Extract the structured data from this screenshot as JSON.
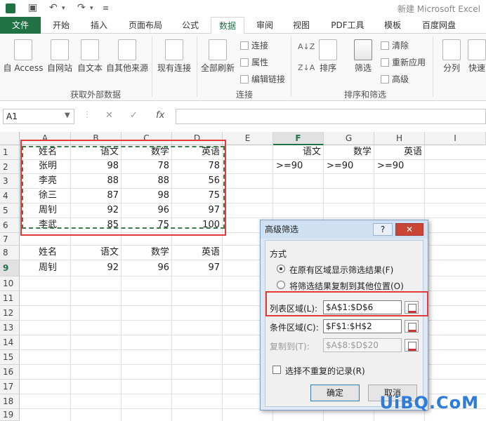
{
  "app": {
    "title": "新建 Microsoft Excel"
  },
  "tabs": [
    "文件",
    "开始",
    "插入",
    "页面布局",
    "公式",
    "数据",
    "审阅",
    "视图",
    "PDF工具",
    "模板",
    "百度网盘"
  ],
  "ribbon": {
    "external_buttons": [
      "自 Access",
      "自网站",
      "自文本",
      "自其他来源",
      "现有连接"
    ],
    "refresh_all": "全部刷新",
    "connections_items": [
      "连接",
      "属性",
      "编辑链接"
    ],
    "sort": "排序",
    "filter": "筛选",
    "filter_items": [
      "清除",
      "重新应用",
      "高级"
    ],
    "split": "分列",
    "quick": "快速",
    "groups": [
      "获取外部数据",
      "连接",
      "排序和筛选"
    ]
  },
  "formula_bar": {
    "name_box": "A1",
    "fx": "fx",
    "cancel": "✕",
    "enter": "✓"
  },
  "sheet": {
    "columns": [
      "A",
      "B",
      "C",
      "D",
      "E",
      "F",
      "G",
      "H",
      "I"
    ],
    "rows": [
      "1",
      "2",
      "3",
      "4",
      "5",
      "6",
      "7",
      "8",
      "9",
      "10",
      "11",
      "12",
      "13",
      "14",
      "15",
      "16",
      "17",
      "18",
      "19"
    ],
    "table": [
      [
        "姓名",
        "语文",
        "数学",
        "英语"
      ],
      [
        "张明",
        "98",
        "78",
        "78"
      ],
      [
        "李亮",
        "88",
        "88",
        "56"
      ],
      [
        "徐三",
        "87",
        "98",
        "75"
      ],
      [
        "周钊",
        "92",
        "96",
        "97"
      ],
      [
        "李武",
        "85",
        "75",
        "100"
      ]
    ],
    "criteria": [
      [
        "语文",
        "数学",
        "英语"
      ],
      [
        ">=90",
        ">=90",
        ">=90"
      ]
    ],
    "result": [
      [
        "姓名",
        "语文",
        "数学",
        "英语"
      ],
      [
        "周钊",
        "92",
        "96",
        "97"
      ]
    ]
  },
  "dialog": {
    "title": "高级筛选",
    "help": "?",
    "close": "✕",
    "mode_label": "方式",
    "option1": "在原有区域显示筛选结果(F)",
    "option2": "将筛选结果复制到其他位置(O)",
    "list_range_label": "列表区域(L):",
    "list_range_value": "$A$1:$D$6",
    "criteria_range_label": "条件区域(C):",
    "criteria_range_value": "$F$1:$H$2",
    "copy_to_label": "复制到(T):",
    "copy_to_value": "$A$8:$D$20",
    "unique_label": "选择不重复的记录(R)",
    "ok": "确定",
    "cancel": "取消"
  },
  "watermark": "UiBQ.CoM"
}
